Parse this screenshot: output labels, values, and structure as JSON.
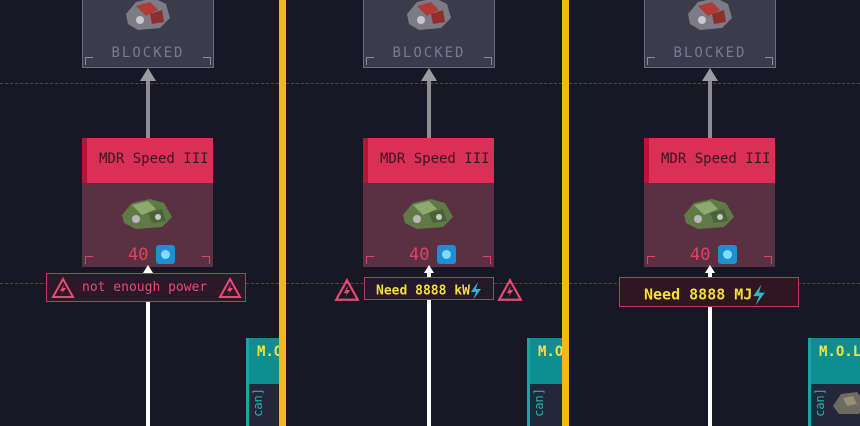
{
  "blocked_label": "BLOCKED",
  "upgrade": {
    "title": "MDR Speed III",
    "cost": "40",
    "cost_icon": "energy-chip-icon"
  },
  "panels": [
    {
      "tooltip": "not enough power"
    },
    {
      "tooltip": "Need 8888 kW"
    },
    {
      "tooltip": "Need 8888 MJ"
    }
  ],
  "side_node": {
    "title": "M.O.L",
    "vertical": "can]"
  },
  "colors": {
    "background": "#181726",
    "divider": "#f3b817",
    "card_header": "#dc2f55",
    "card_body": "#5a3143",
    "warning": "#e94a72",
    "need_text": "#f5df3c",
    "teal": "#0f8e92"
  }
}
